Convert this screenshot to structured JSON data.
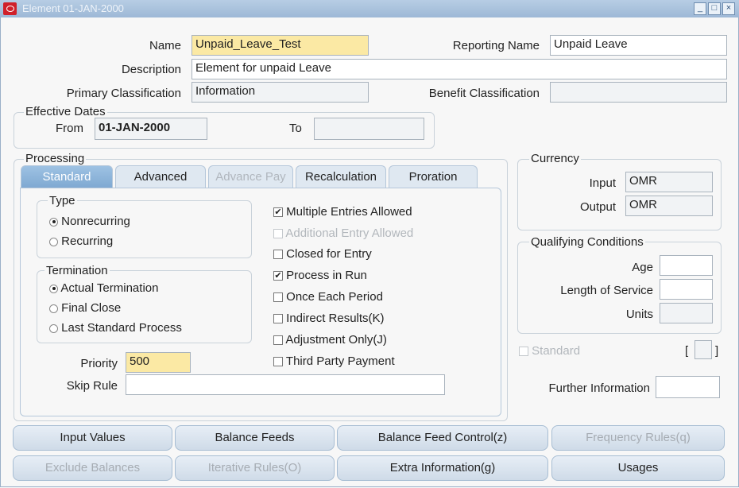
{
  "window": {
    "title": "Element 01-JAN-2000",
    "minimize": "_",
    "maximize": "□",
    "close": "×"
  },
  "header": {
    "name_label": "Name",
    "name_value": "Unpaid_Leave_Test",
    "reporting_name_label": "Reporting Name",
    "reporting_name_value": "Unpaid Leave",
    "description_label": "Description",
    "description_value": "Element for unpaid Leave",
    "primary_classification_label": "Primary Classification",
    "primary_classification_value": "Information",
    "benefit_classification_label": "Benefit Classification",
    "benefit_classification_value": ""
  },
  "effective_dates": {
    "title": "Effective Dates",
    "from_label": "From",
    "from_value": "01-JAN-2000",
    "to_label": "To",
    "to_value": ""
  },
  "processing": {
    "title": "Processing",
    "tabs": [
      {
        "label": "Standard",
        "active": true
      },
      {
        "label": "Advanced"
      },
      {
        "label": "Advance Pay",
        "disabled": true
      },
      {
        "label": "Recalculation"
      },
      {
        "label": "Proration"
      }
    ],
    "type": {
      "title": "Type",
      "options": [
        "Nonrecurring",
        "Recurring"
      ],
      "selected": "Nonrecurring"
    },
    "termination": {
      "title": "Termination",
      "options": [
        "Actual Termination",
        "Final Close",
        "Last Standard Process"
      ],
      "selected": "Actual Termination"
    },
    "checkboxes": [
      {
        "label": "Multiple Entries Allowed",
        "checked": true
      },
      {
        "label": "Additional Entry Allowed",
        "checked": false,
        "disabled": true
      },
      {
        "label": "Closed for Entry",
        "checked": false
      },
      {
        "label": "Process in Run",
        "checked": true
      },
      {
        "label": "Once Each Period",
        "checked": false
      },
      {
        "label": "Indirect Results(K)",
        "checked": false
      },
      {
        "label": "Adjustment Only(J)",
        "checked": false
      },
      {
        "label": "Third Party Payment",
        "checked": false
      }
    ],
    "check_mark": "✔",
    "priority_label": "Priority",
    "priority_value": "500",
    "skip_rule_label": "Skip Rule",
    "skip_rule_value": ""
  },
  "currency": {
    "title": "Currency",
    "input_label": "Input",
    "input_value": "OMR",
    "output_label": "Output",
    "output_value": "OMR"
  },
  "qualifying": {
    "title": "Qualifying Conditions",
    "age_label": "Age",
    "age_value": "",
    "los_label": "Length of Service",
    "los_value": "",
    "units_label": "Units",
    "units_value": ""
  },
  "standard_check": {
    "label": "Standard",
    "checked": false,
    "disabled": true
  },
  "flex": {
    "open": "[",
    "close": "]"
  },
  "further_info": {
    "label": "Further Information",
    "value": ""
  },
  "buttons": [
    {
      "label": "Input Values",
      "disabled": false
    },
    {
      "label": "Balance Feeds",
      "disabled": false
    },
    {
      "label": "Balance Feed Control(z)",
      "disabled": false
    },
    {
      "label": "Frequency Rules(q)",
      "disabled": true
    },
    {
      "label": "Exclude Balances",
      "disabled": true
    },
    {
      "label": "Iterative Rules(O)",
      "disabled": true
    },
    {
      "label": "Extra Information(g)",
      "disabled": false
    },
    {
      "label": "Usages",
      "disabled": false
    }
  ]
}
